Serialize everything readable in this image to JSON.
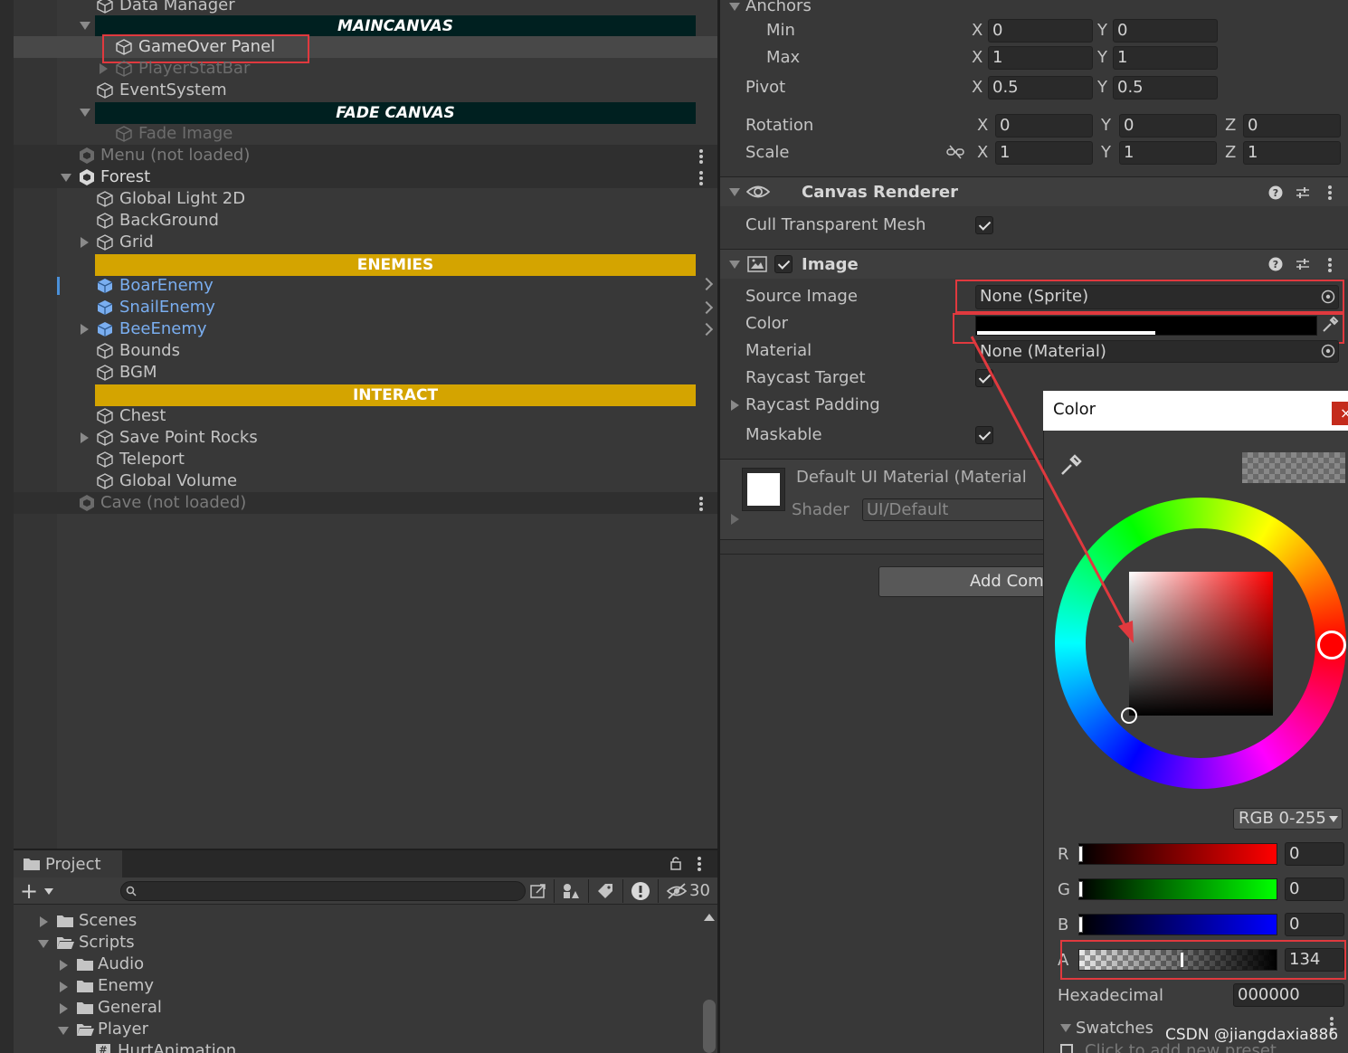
{
  "hierarchy": {
    "items": {
      "data_manager": "Data Manager",
      "maincanvas": "MAINCANVAS",
      "gameover_panel": "GameOver Panel",
      "player_statbar": "PlayerStatBar",
      "event_system": "EventSystem",
      "fade_canvas": "FADE CANVAS",
      "fade_image": "Fade Image",
      "menu": "Menu (not loaded)",
      "forest": "Forest",
      "global_light": "Global Light 2D",
      "background": "BackGround",
      "grid": "Grid",
      "enemies": "ENEMIES",
      "boar_enemy": "BoarEnemy",
      "snail_enemy": "SnailEnemy",
      "bee_enemy": "BeeEnemy",
      "bounds": "Bounds",
      "bgm": "BGM",
      "interact": "INTERACT",
      "chest": "Chest",
      "save_point_rocks": "Save Point Rocks",
      "teleport": "Teleport",
      "global_volume": "Global Volume",
      "cave": "Cave (not loaded)"
    }
  },
  "project": {
    "tab": "Project",
    "hidden_count": "30",
    "folders": {
      "scenes": "Scenes",
      "scripts": "Scripts",
      "audio": "Audio",
      "enemy": "Enemy",
      "general": "General",
      "player": "Player",
      "hurt_animation": "HurtAnimation"
    }
  },
  "inspector": {
    "anchors": {
      "label": "Anchors",
      "min": "Min",
      "max": "Max",
      "min_x": "0",
      "min_y": "0",
      "max_x": "1",
      "max_y": "1"
    },
    "pivot": {
      "label": "Pivot",
      "x": "0.5",
      "y": "0.5"
    },
    "rotation": {
      "label": "Rotation",
      "x": "0",
      "y": "0",
      "z": "0"
    },
    "scale": {
      "label": "Scale",
      "x": "1",
      "y": "1",
      "z": "1"
    },
    "axis": {
      "x": "X",
      "y": "Y",
      "z": "Z"
    },
    "canvas_renderer": {
      "title": "Canvas Renderer",
      "cull_label": "Cull Transparent Mesh"
    },
    "image": {
      "title": "Image",
      "source_image_label": "Source Image",
      "source_image_value": "None (Sprite)",
      "color_label": "Color",
      "material_label": "Material",
      "material_value": "None (Material)",
      "raycast_target_label": "Raycast Target",
      "raycast_padding_label": "Raycast Padding",
      "maskable_label": "Maskable"
    },
    "material_block": {
      "name": "Default UI Material (Material",
      "shader_label": "Shader",
      "shader_value": "UI/Default"
    },
    "add_component": "Add Comp"
  },
  "color_picker": {
    "title": "Color",
    "mode": "RGB 0-255",
    "channels": {
      "r_label": "R",
      "r_value": "0",
      "g_label": "G",
      "g_value": "0",
      "b_label": "B",
      "b_value": "0",
      "a_label": "A",
      "a_value": "134"
    },
    "hex_label": "Hexadecimal",
    "hex_value": "000000",
    "swatches_label": "Swatches",
    "add_preset": "Click to add new preset",
    "alpha_fraction": 0.525
  },
  "watermark": "CSDN @jiangdaxia886",
  "colors": {
    "maincanvas_bg": "#002020",
    "enemies_bg": "#d4a400",
    "prefab_blue": "#7aaef0",
    "highlight_red": "#e0393e"
  }
}
